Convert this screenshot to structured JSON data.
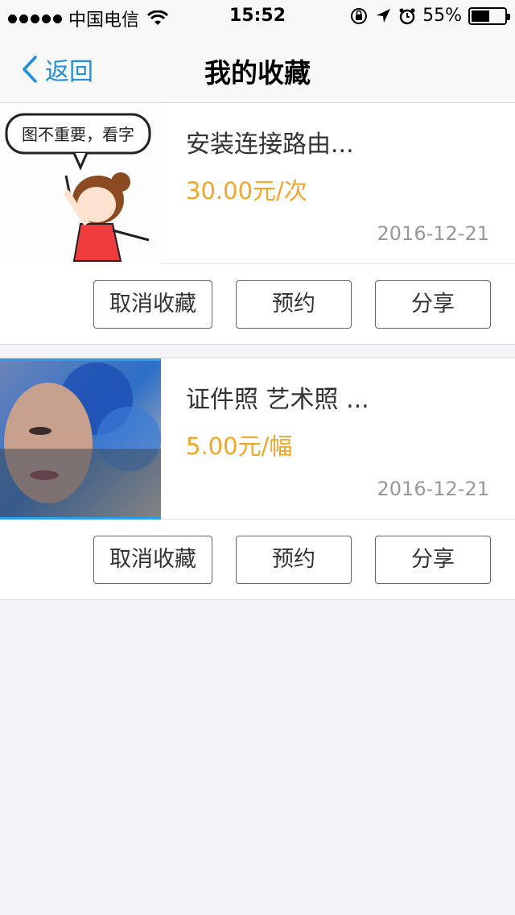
{
  "status_bar": {
    "carrier": "中国电信",
    "time": "15:52",
    "battery_percent": "55%",
    "battery_level": 0.55,
    "icons": [
      "signal-dots",
      "wifi-icon",
      "orientation-lock-icon",
      "location-arrow-icon",
      "alarm-icon",
      "battery-icon"
    ]
  },
  "nav": {
    "back_label": "返回",
    "title": "我的收藏"
  },
  "favorites": [
    {
      "title": "安装连接路由...",
      "price": "30.00元/次",
      "date": "2016-12-21",
      "thumbnail_caption": "图不重要，看字",
      "actions": {
        "cancel": "取消收藏",
        "book": "预约",
        "share": "分享"
      }
    },
    {
      "title": "证件照 艺术照 ...",
      "price": "5.00元/幅",
      "date": "2016-12-21",
      "actions": {
        "cancel": "取消收藏",
        "book": "预约",
        "share": "分享"
      }
    }
  ],
  "colors": {
    "accent": "#1e8fe1",
    "price": "#f5a623",
    "background": "#f4f3f8"
  }
}
